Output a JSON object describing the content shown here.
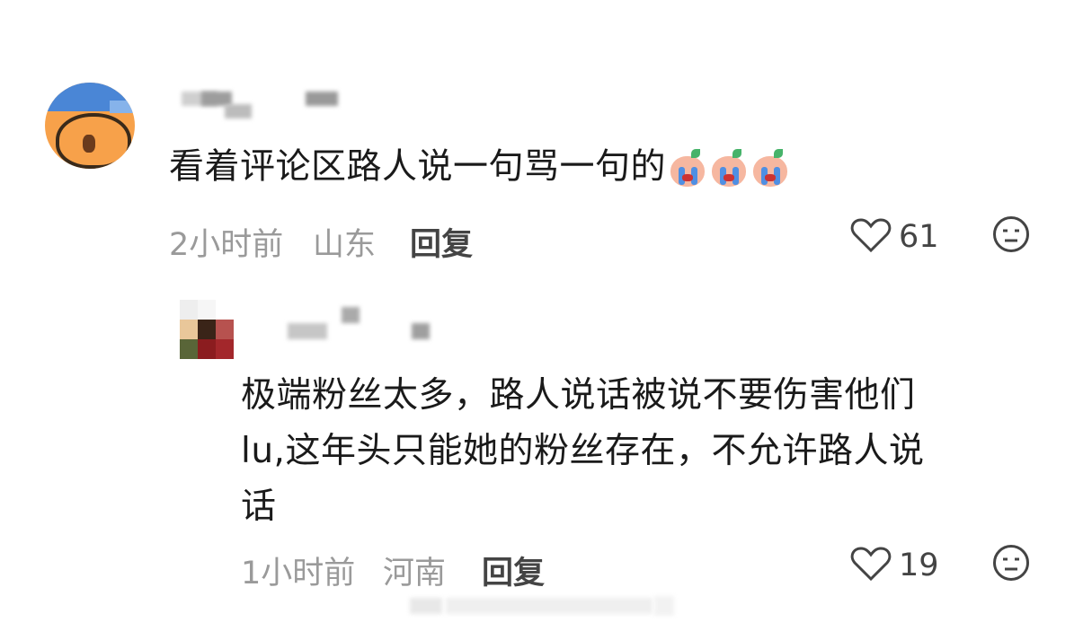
{
  "comment": {
    "text": "看着评论区路人说一句骂一句的",
    "emojis": [
      "crying-emoji",
      "crying-emoji",
      "crying-emoji"
    ],
    "time": "2小时前",
    "location": "山东",
    "reply_label": "回复",
    "like_count": "61"
  },
  "reply": {
    "text_lines": [
      "极端粉丝太多，路人说话被说不要伤害他们",
      "lu,这年头只能她的粉丝存在，不允许路人说",
      "话"
    ],
    "time": "1小时前",
    "location": "河南",
    "reply_label": "回复",
    "like_count": "19"
  },
  "icons": {
    "like": "heart-icon",
    "reaction": "neutral-face-icon"
  },
  "colors": {
    "meta": "#9a9a9a",
    "text": "#1a1a1a",
    "avatar_orange": "#f7a14a",
    "avatar_blue": "#4a86d6"
  }
}
